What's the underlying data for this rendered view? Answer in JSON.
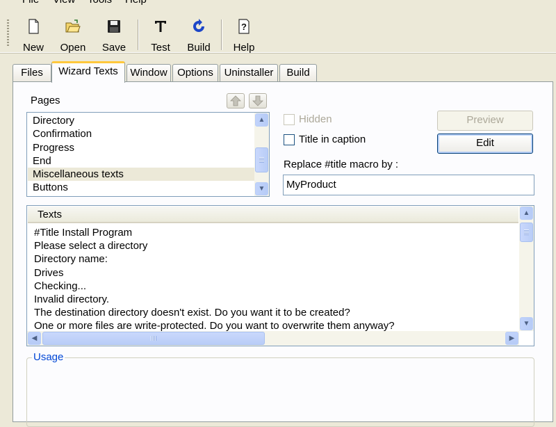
{
  "menu": [
    "File",
    "View",
    "Tools",
    "Help"
  ],
  "toolbar": {
    "new": {
      "label": "New",
      "icon": "new-document-icon"
    },
    "open": {
      "label": "Open",
      "icon": "open-folder-icon"
    },
    "save": {
      "label": "Save",
      "icon": "floppy-disk-icon"
    },
    "test": {
      "label": "Test",
      "icon": "text-T-icon"
    },
    "build": {
      "label": "Build",
      "icon": "build-arrow-icon"
    },
    "help": {
      "label": "Help",
      "icon": "help-question-icon"
    }
  },
  "tabs": [
    {
      "label": "Files"
    },
    {
      "label": "Wizard Texts",
      "active": true
    },
    {
      "label": "Window"
    },
    {
      "label": "Options"
    },
    {
      "label": "Uninstaller"
    },
    {
      "label": "Build"
    }
  ],
  "pages": {
    "label": "Pages",
    "items": [
      "Directory",
      "Confirmation",
      "Progress",
      "End",
      "Miscellaneous texts",
      "Buttons"
    ],
    "selected_index": 4
  },
  "options": {
    "hidden_label": "Hidden",
    "hidden_checked": false,
    "hidden_enabled": false,
    "title_caption_label": "Title in caption",
    "title_caption_checked": false,
    "preview_label": "Preview",
    "edit_label": "Edit",
    "replace_label": "Replace #title macro by :",
    "replace_value": "MyProduct"
  },
  "texts": {
    "header": "Texts",
    "rows": [
      "#Title Install Program",
      "Please select a directory",
      "Directory name:",
      "Drives",
      "Checking...",
      "Invalid directory.",
      "The destination directory doesn't exist. Do you want it to be created?",
      "One or more files are write-protected. Do you want to overwrite them anyway?"
    ]
  },
  "usage": {
    "label": "Usage"
  },
  "colors": {
    "accent_tab": "#ffc83c",
    "group_legend": "#0046d5",
    "window_bg": "#ece9d8"
  }
}
